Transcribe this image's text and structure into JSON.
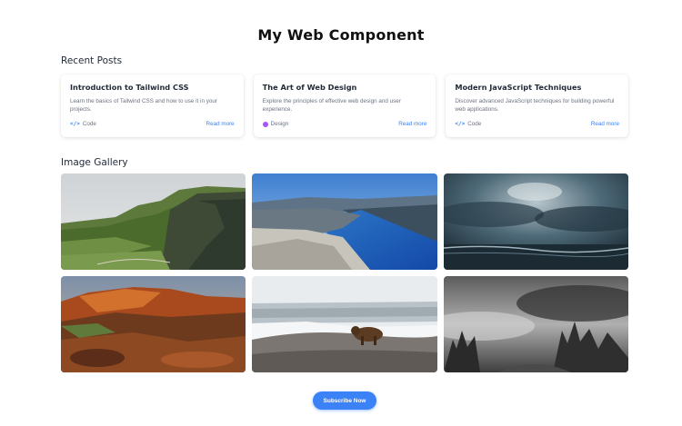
{
  "page": {
    "title": "My Web Component"
  },
  "recent_posts": {
    "heading": "Recent Posts",
    "items": [
      {
        "title": "Introduction to Tailwind CSS",
        "description": "Learn the basics of Tailwind CSS and how to use it in your projects.",
        "tag": "Code",
        "tag_icon": "code-icon",
        "link": "Read more"
      },
      {
        "title": "The Art of Web Design",
        "description": "Explore the principles of effective web design and user experience.",
        "tag": "Design",
        "tag_icon": "palette-icon",
        "link": "Read more"
      },
      {
        "title": "Modern JavaScript Techniques",
        "description": "Discover advanced JavaScript techniques for building powerful web applications.",
        "tag": "Code",
        "tag_icon": "code-icon",
        "link": "Read more"
      }
    ]
  },
  "gallery": {
    "heading": "Image Gallery",
    "images": [
      {
        "subject": "green-cliffs"
      },
      {
        "subject": "fjord"
      },
      {
        "subject": "stormy-sea"
      },
      {
        "subject": "red-canyon"
      },
      {
        "subject": "bear-snow"
      },
      {
        "subject": "foggy-forest"
      }
    ]
  },
  "cta": {
    "subscribe_label": "Subscribe Now"
  },
  "colors": {
    "accent": "#3b82f6",
    "design_tag": "#a855f7",
    "text_muted": "#6b7280"
  }
}
